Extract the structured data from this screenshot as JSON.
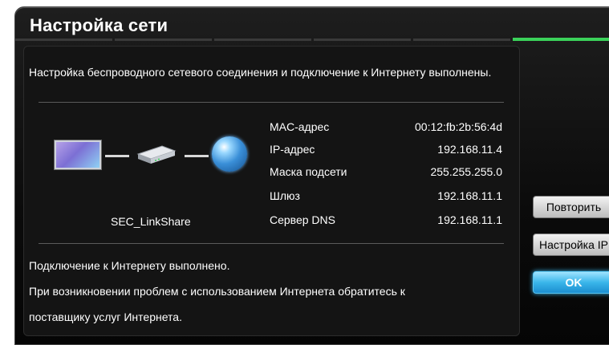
{
  "dialog": {
    "title": "Настройка сети",
    "progress": {
      "segments": 6,
      "active_index": 5,
      "active_color": "#3bd25a"
    }
  },
  "status_message": "Настройка беспроводного сетевого соединения и подключение к Интернету выполнены.",
  "diagram": {
    "device_icon": "tv-icon",
    "router_icon": "router-icon",
    "internet_icon": "globe-icon",
    "network_name": "SEC_LinkShare"
  },
  "network_info": [
    {
      "label": "MAC-адрес",
      "value": "00:12:fb:2b:56:4d"
    },
    {
      "label": "IP-адрес",
      "value": "192.168.11.4"
    },
    {
      "label": "Маска подсети",
      "value": "255.255.255.0"
    },
    {
      "label": "Шлюз",
      "value": "192.168.11.1"
    },
    {
      "label": "Сервер DNS",
      "value": "192.168.11.1"
    }
  ],
  "result": {
    "line1": "Подключение к Интернету выполнено.",
    "line2": "При возникновении проблем с использованием Интернета обратитесь к",
    "line3": "поставщику услуг Интернета."
  },
  "buttons": {
    "retry": "Повторить",
    "ip_settings": "Настройка IP",
    "ok": "OK"
  }
}
